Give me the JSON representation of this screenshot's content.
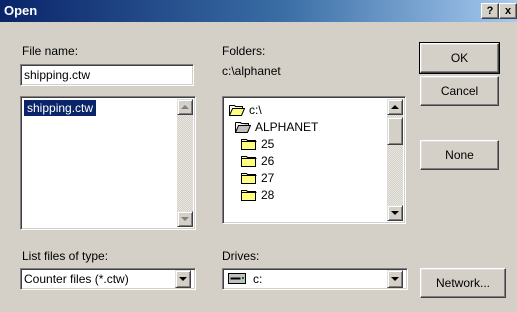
{
  "window": {
    "title": "Open"
  },
  "titlebar": {
    "help_glyph": "?",
    "close_glyph": "x"
  },
  "file_name": {
    "label": "File name:",
    "value": "shipping.ctw",
    "files": [
      "shipping.ctw"
    ]
  },
  "folders": {
    "label": "Folders:",
    "path": "c:\\alphanet",
    "tree": [
      {
        "name": "c:\\",
        "icon": "open-folder-icon"
      },
      {
        "name": "ALPHANET",
        "icon": "open-folder-icon"
      },
      {
        "name": "25",
        "icon": "folder-icon"
      },
      {
        "name": "26",
        "icon": "folder-icon"
      },
      {
        "name": "27",
        "icon": "folder-icon"
      },
      {
        "name": "28",
        "icon": "folder-icon"
      }
    ]
  },
  "file_type": {
    "label": "List files of type:",
    "value": "Counter files (*.ctw)"
  },
  "drives": {
    "label": "Drives:",
    "value": "c:",
    "icon": "drive-icon"
  },
  "buttons": {
    "ok": "OK",
    "cancel": "Cancel",
    "none": "None",
    "network": "Network..."
  }
}
